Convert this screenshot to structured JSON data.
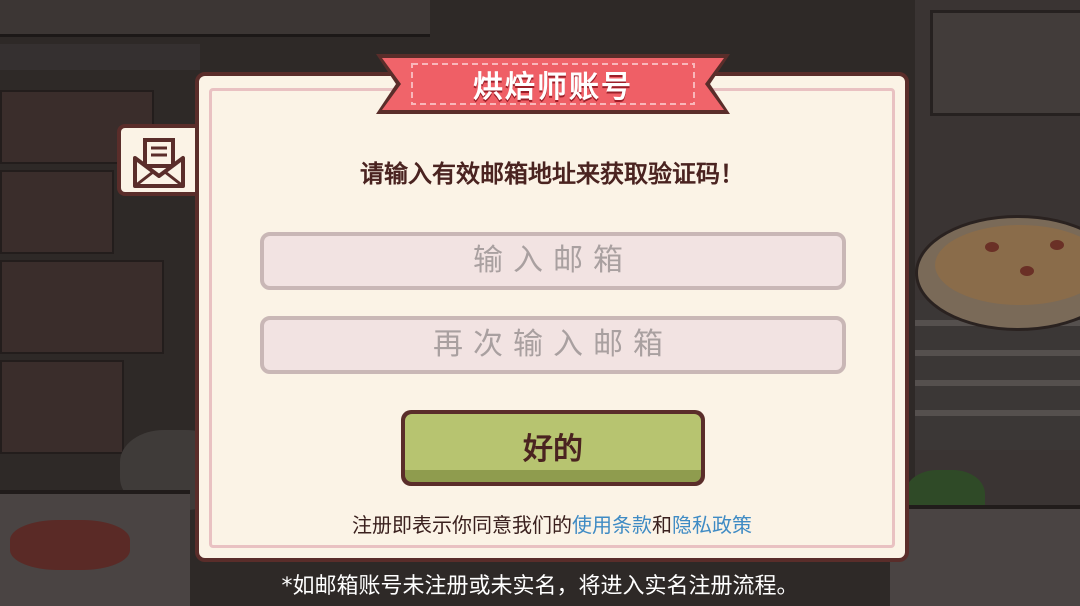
{
  "dialog": {
    "title": "烘焙师账号",
    "prompt": "请输入有效邮箱地址来获取验证码！",
    "email_placeholder": "输入邮箱",
    "email_confirm_placeholder": "再次输入邮箱",
    "ok_label": "好的",
    "terms_prefix": "注册即表示你同意我们的",
    "terms_link": "使用条款",
    "terms_and": "和",
    "privacy_link": "隐私政策",
    "icon": "mail-icon"
  },
  "footnote": "*如邮箱账号未注册或未实名，将进入实名注册流程。",
  "colors": {
    "ribbon": "#f0646a",
    "button": "#b7c470",
    "link": "#3f8bc4",
    "border": "#5a2d2a"
  }
}
